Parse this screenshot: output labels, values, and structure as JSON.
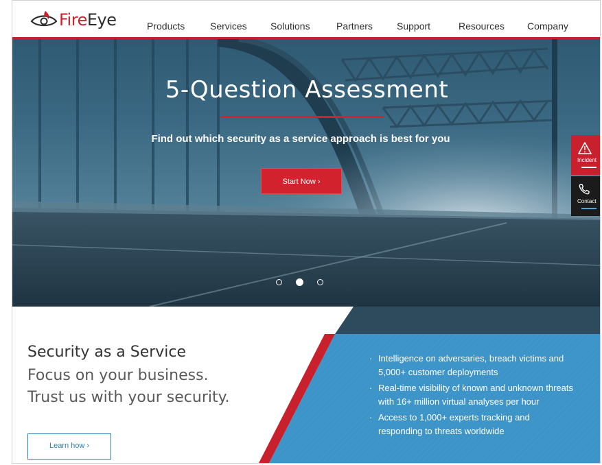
{
  "brand": {
    "logo_text_red": "Fire",
    "logo_text_dark": "Eye",
    "accent_color": "#c8212d"
  },
  "nav": {
    "items": [
      {
        "label": "Products"
      },
      {
        "label": "Services"
      },
      {
        "label": "Solutions"
      },
      {
        "label": "Partners"
      },
      {
        "label": "Support"
      },
      {
        "label": "Resources"
      },
      {
        "label": "Company"
      }
    ]
  },
  "hero": {
    "title": "5-Question Assessment",
    "subtitle": "Find out which security as a service approach is best for you",
    "cta_label": "Start Now ›",
    "slide_count": 3,
    "active_slide": 2
  },
  "side_tabs": {
    "incident_label": "Incident",
    "incident_icon": "warning-triangle-icon",
    "contact_label": "Contact",
    "contact_icon": "phone-icon"
  },
  "promo": {
    "title": "Security as a Service",
    "line1": "Focus on your business.",
    "line2": "Trust us with your security.",
    "button_label": "Learn how ›",
    "bullets": [
      "Intelligence on adversaries, breach victims and 5,000+ customer deployments",
      "Real-time visibility of known and unknown threats with 16+ million virtual analyses per hour",
      "Access to 1,000+ experts tracking and responding to threats worldwide"
    ]
  }
}
